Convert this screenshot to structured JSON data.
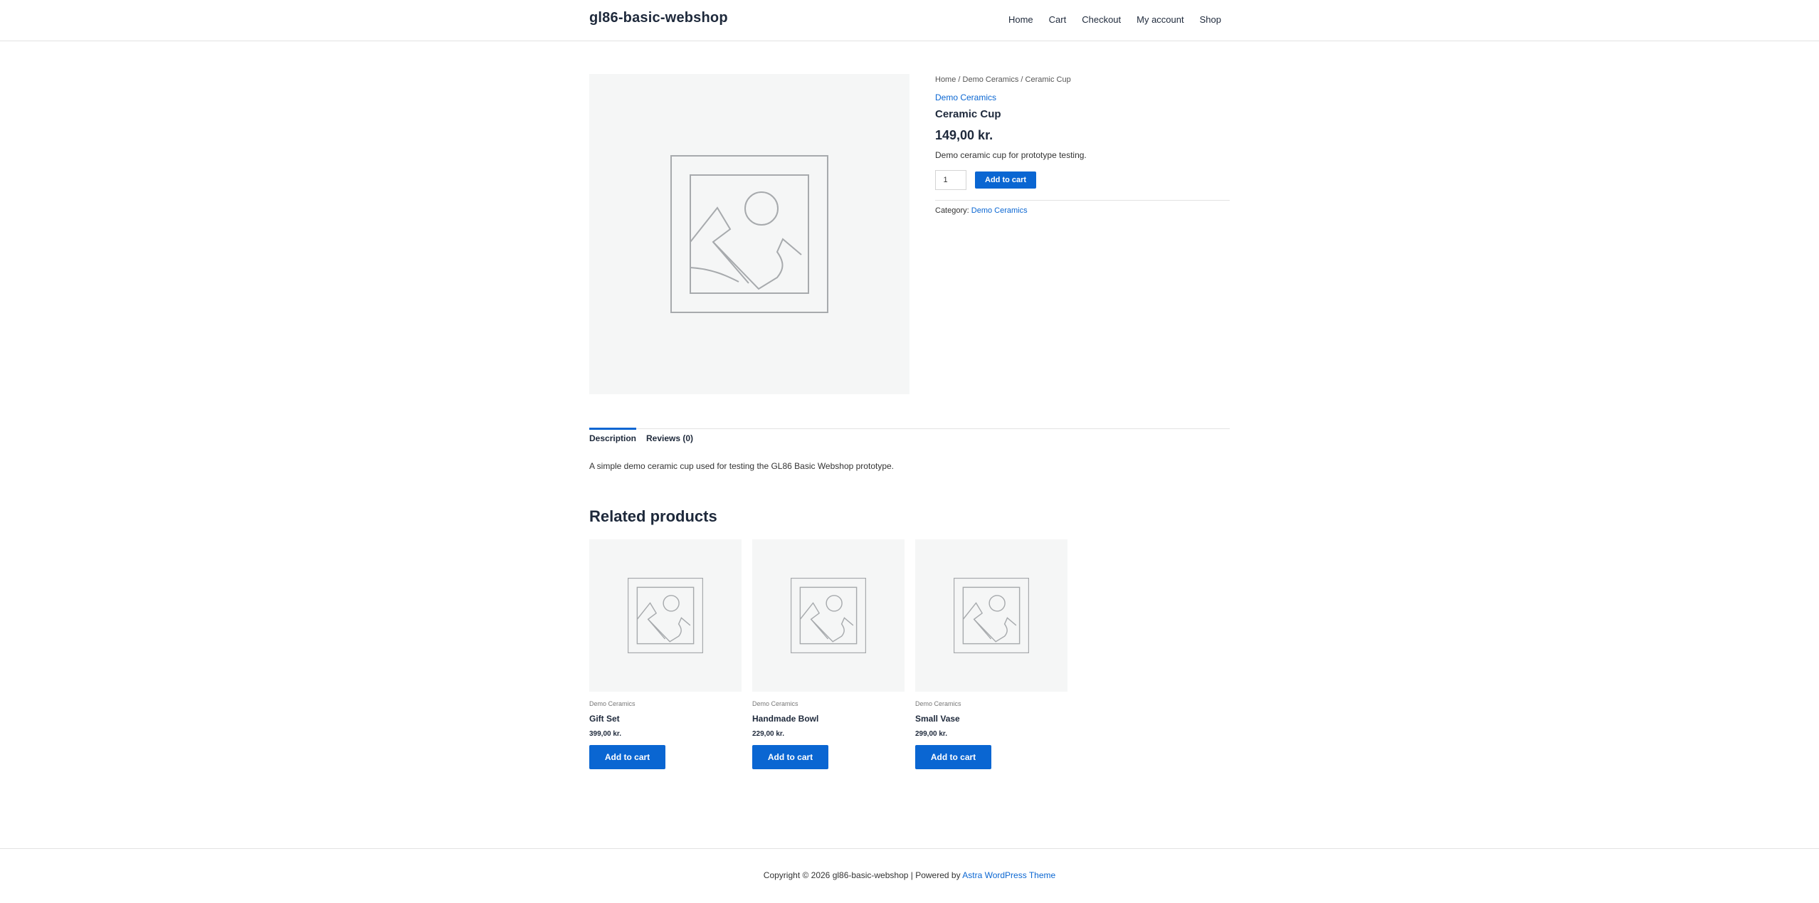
{
  "header": {
    "site_title": "gl86-basic-webshop",
    "nav": [
      "Home",
      "Cart",
      "Checkout",
      "My account",
      "Shop"
    ]
  },
  "breadcrumb": {
    "home": "Home",
    "sep1": " / ",
    "category": "Demo Ceramics",
    "sep2": " / ",
    "current": "Ceramic Cup"
  },
  "product": {
    "category": "Demo Ceramics",
    "title": "Ceramic Cup",
    "price": "149,00 kr.",
    "short_description": "Demo ceramic cup for prototype testing.",
    "quantity": "1",
    "add_to_cart": "Add to cart",
    "meta_label": "Category:",
    "meta_category": "Demo Ceramics",
    "image_icon": "image-placeholder-icon"
  },
  "tabs": {
    "description": "Description",
    "reviews": "Reviews (0)",
    "panel_text": "A simple demo ceramic cup used for testing the GL86 Basic Webshop prototype."
  },
  "related": {
    "heading": "Related products",
    "items": [
      {
        "category": "Demo Ceramics",
        "title": "Gift Set",
        "price": "399,00 kr.",
        "button": "Add to cart"
      },
      {
        "category": "Demo Ceramics",
        "title": "Handmade Bowl",
        "price": "229,00 kr.",
        "button": "Add to cart"
      },
      {
        "category": "Demo Ceramics",
        "title": "Small Vase",
        "price": "299,00 kr.",
        "button": "Add to cart"
      }
    ]
  },
  "footer": {
    "copyright": "Copyright © 2026 gl86-basic-webshop | Powered by ",
    "link": "Astra WordPress Theme"
  },
  "colors": {
    "accent": "#0a66d2",
    "text": "#1e293b",
    "placeholder_bg": "#f5f6f6"
  }
}
